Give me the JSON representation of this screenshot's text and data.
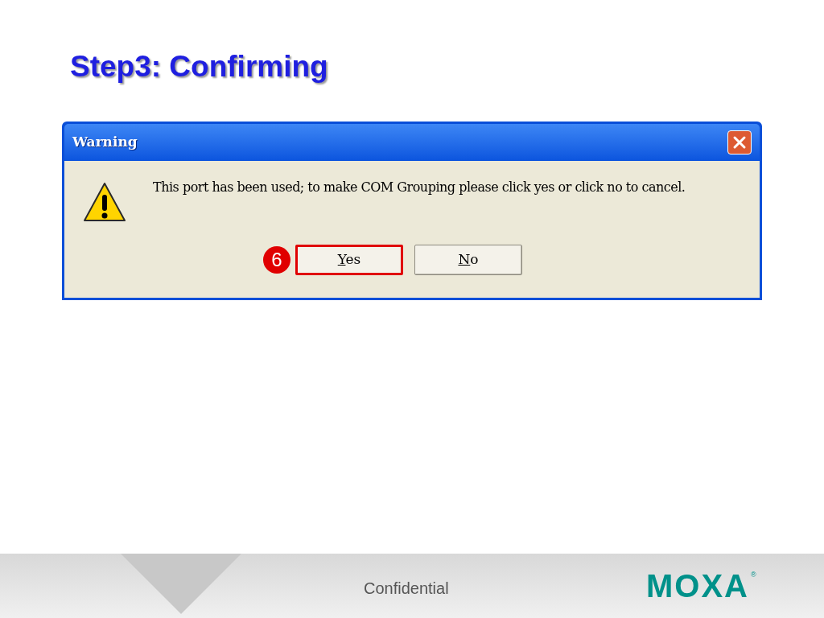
{
  "slide_title": "Step3: Confirming",
  "dialog": {
    "title": "Warning",
    "message": "This port has been used; to make COM Grouping please click yes or click no to cancel.",
    "buttons": [
      {
        "label": "Yes",
        "highlighted": true,
        "step": "6"
      },
      {
        "label": "No",
        "highlighted": false
      }
    ]
  },
  "footer": {
    "text": "Confidential",
    "logo": "MOXA",
    "logo_mark": "®"
  }
}
